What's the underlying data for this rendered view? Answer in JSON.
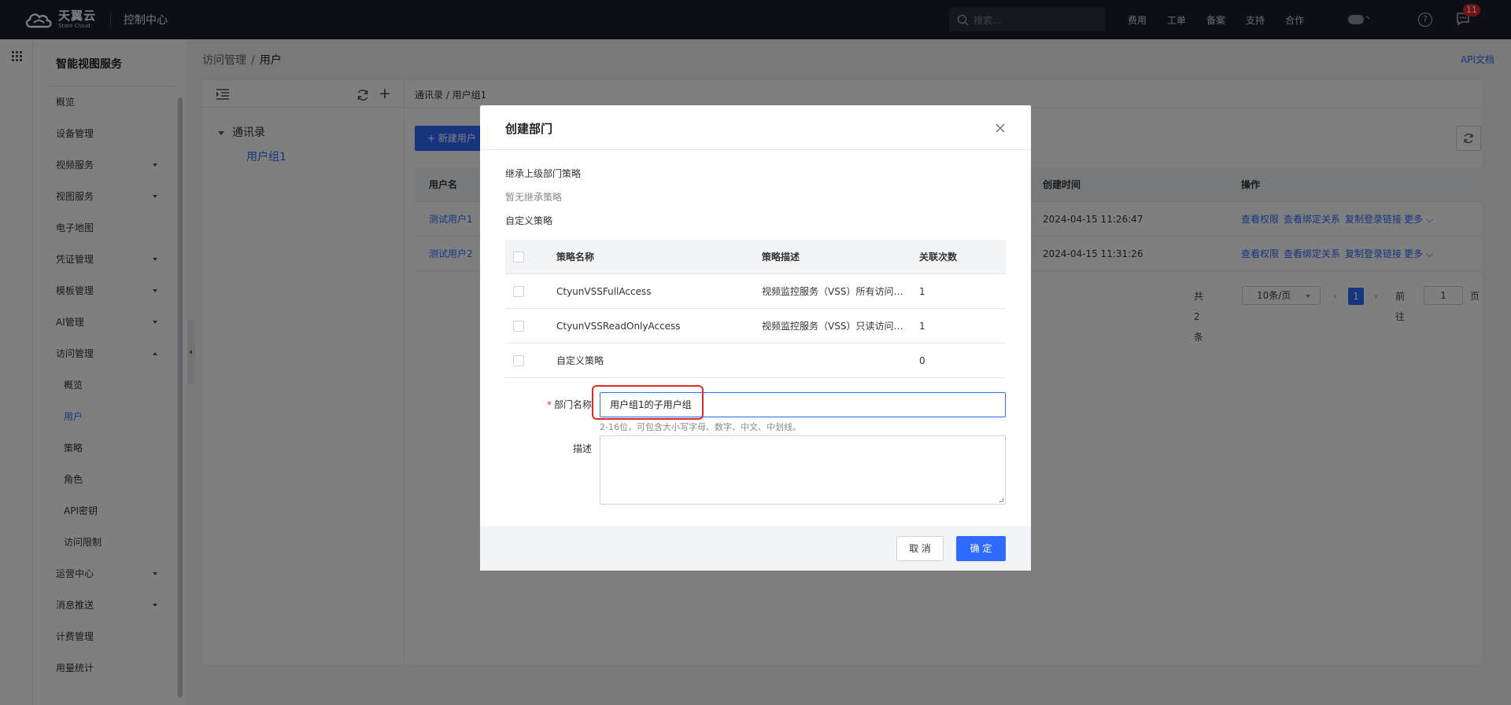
{
  "header": {
    "logo_cn": "天翼云",
    "logo_en": "State Cloud",
    "console_title": "控制中心",
    "search_placeholder": "搜索...",
    "nav": [
      "费用",
      "工单",
      "备案",
      "支持",
      "合作"
    ],
    "badge_count": "11"
  },
  "sidebar": {
    "title": "智能视图服务",
    "items": [
      {
        "label": "概览"
      },
      {
        "label": "设备管理"
      },
      {
        "label": "视频服务"
      },
      {
        "label": "视图服务"
      },
      {
        "label": "电子地图"
      },
      {
        "label": "凭证管理"
      },
      {
        "label": "模板管理"
      },
      {
        "label": "AI管理"
      },
      {
        "label": "访问管理"
      },
      {
        "label": "概览"
      },
      {
        "label": "用户"
      },
      {
        "label": "策略"
      },
      {
        "label": "角色"
      },
      {
        "label": "API密钥"
      },
      {
        "label": "访问限制"
      },
      {
        "label": "运营中心"
      },
      {
        "label": "消息推送"
      },
      {
        "label": "计费管理"
      },
      {
        "label": "用量统计"
      }
    ]
  },
  "breadcrumb": {
    "parent": "访问管理",
    "sep": "/",
    "current": "用户"
  },
  "api_doc": "API文档",
  "tree": {
    "root": "通讯录",
    "child": "用户组1"
  },
  "right_breadcrumb": "通讯录 / 用户组1",
  "new_user_button": "+ 新建用户",
  "table": {
    "columns": {
      "username": "用户名",
      "created": "创建时间",
      "actions": "操作"
    },
    "rows": [
      {
        "username": "测试用户1",
        "created": "2024-04-15 11:26:47"
      },
      {
        "username": "测试用户2",
        "created": "2024-04-15 11:31:26"
      }
    ],
    "actions": {
      "perm": "查看权限",
      "bind": "查看绑定关系",
      "copy": "复制登录链接",
      "more": "更多 ⌵"
    }
  },
  "pagination": {
    "total": "共 2 条",
    "page_size": "10条/页",
    "current": "1",
    "goto_label": "前往",
    "goto_value": "1",
    "page_unit": "页"
  },
  "modal": {
    "title": "创建部门",
    "inherit_label": "继承上级部门策略",
    "inherit_empty": "暂无继承策略",
    "custom_label": "自定义策略",
    "policy_columns": {
      "name": "策略名称",
      "desc": "策略描述",
      "count": "关联次数"
    },
    "policies": [
      {
        "name": "CtyunVSSFullAccess",
        "desc": "视频监控服务（VSS）所有访问权限",
        "count": "1"
      },
      {
        "name": "CtyunVSSReadOnlyAccess",
        "desc": "视频监控服务（VSS）只读访问权限",
        "count": "1"
      },
      {
        "name": "自定义策略",
        "desc": "",
        "count": "0"
      }
    ],
    "dept_name_required": "*",
    "dept_name_label": "部门名称",
    "dept_name_value": "用户组1的子用户组",
    "dept_name_hint": "2-16位，可包含大小写字母、数字、中文、中划线。",
    "desc_label": "描述",
    "desc_value": "",
    "cancel": "取 消",
    "confirm": "确 定"
  },
  "colors": {
    "primary": "#2f6bff",
    "topbar": "#1b1f2c",
    "danger": "#e02b2b"
  }
}
